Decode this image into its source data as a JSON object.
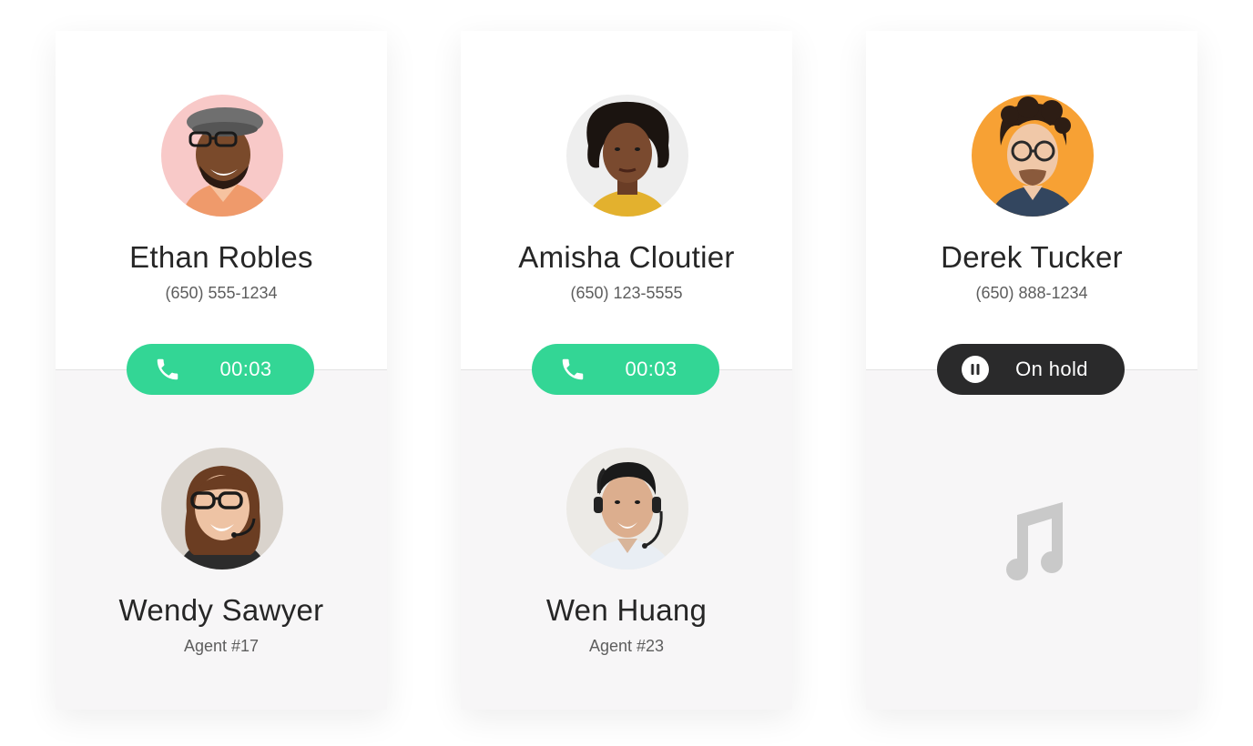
{
  "calls": [
    {
      "caller": {
        "name": "Ethan Robles",
        "phone": "(650) 555-1234",
        "avatar_icon": "caller-photo-ethan",
        "avatar_bg": "#f8c9c8"
      },
      "status": {
        "type": "active",
        "label": "00:03",
        "icon": "phone-icon",
        "color": "#33d695"
      },
      "agent": {
        "name": "Wendy Sawyer",
        "id_label": "Agent #17",
        "avatar_icon": "agent-photo-wendy"
      }
    },
    {
      "caller": {
        "name": "Amisha Cloutier",
        "phone": "(650) 123-5555",
        "avatar_icon": "caller-photo-amisha",
        "avatar_bg": "#eeeeee"
      },
      "status": {
        "type": "active",
        "label": "00:03",
        "icon": "phone-icon",
        "color": "#33d695"
      },
      "agent": {
        "name": "Wen Huang",
        "id_label": "Agent #23",
        "avatar_icon": "agent-photo-wen"
      }
    },
    {
      "caller": {
        "name": "Derek Tucker",
        "phone": "(650) 888-1234",
        "avatar_icon": "caller-photo-derek",
        "avatar_bg": "#f7a134"
      },
      "status": {
        "type": "hold",
        "label": "On hold",
        "icon": "pause-icon",
        "color": "#2a2a2b"
      },
      "agent": {
        "placeholder_icon": "music-note-icon"
      }
    }
  ]
}
